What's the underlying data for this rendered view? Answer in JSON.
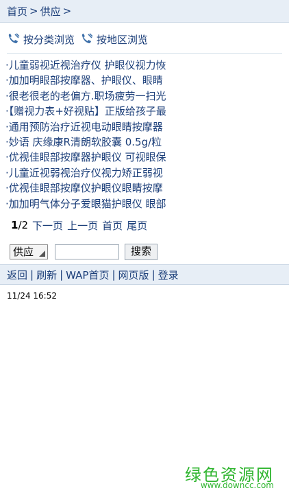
{
  "breadcrumb": {
    "home": "首页",
    "sep1": ">",
    "current": "供应",
    "sep2": ">"
  },
  "browse": {
    "by_category": "按分类浏览",
    "by_region": "按地区浏览"
  },
  "list_items": [
    "·儿童弱视近视治疗仪 护眼仪视力恢",
    "·加加明眼部按摩器、护眼仪、眼睛",
    "·很老很老的老偏方.职场疲劳一扫光",
    "·【赠视力表+好视贴】正版给孩子最",
    "·通用预防治疗近视电动眼睛按摩器",
    "·妙语 庆缘康R清朗软胶囊 0.5g/粒",
    "·优视佳眼部按摩器护眼仪 可视眼保",
    "·儿童近视弱视治疗仪视力矫正弱视",
    "·优视佳眼部按摩仪护眼仪眼睛按摩",
    "·加加明气体分子爱眼猫护眼仪 眼部"
  ],
  "pager": {
    "current": "1",
    "total": "/2",
    "next": "下一页",
    "prev": "上一页",
    "first": "首页",
    "last": "尾页"
  },
  "search": {
    "select_value": "供应",
    "input_value": "",
    "button": "搜索"
  },
  "footer": {
    "back": "返回",
    "refresh": "刷新",
    "wap_home": "WAP首页",
    "web_version": "网页版",
    "login": "登录",
    "sep": "|"
  },
  "timestamp": "11/24 16:52",
  "watermark": {
    "main": "绿色资源网",
    "sub": "www.downcc.com"
  },
  "colors": {
    "link": "#1c3f7a",
    "bar_bg": "#e7eef6",
    "watermark": "#2fb52f"
  }
}
